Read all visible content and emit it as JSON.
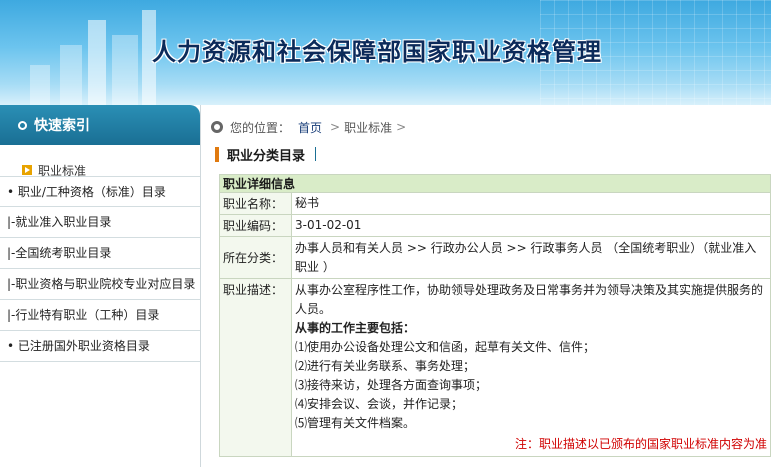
{
  "banner": {
    "title": "人力资源和社会保障部国家职业资格管理"
  },
  "sidebar": {
    "header": "快速索引",
    "sub_item": "职业标准",
    "items": [
      "• 职业/工种资格（标准）目录",
      "|-就业准入职业目录",
      "|-全国统考职业目录",
      "|-职业资格与职业院校专业对应目录",
      "|-行业特有职业（工种）目录",
      "• 已注册国外职业资格目录"
    ]
  },
  "breadcrumb": {
    "prefix": "您的位置：",
    "home": "首页",
    "sep": ">",
    "current": "职业标准",
    "tail_sep": ">"
  },
  "section": {
    "title": "职业分类目录"
  },
  "detail": {
    "header": "职业详细信息",
    "name_label": "职业名称：",
    "name_value": "秘书",
    "code_label": "职业编码：",
    "code_value": "3-01-02-01",
    "category_label": "所在分类：",
    "category_value": "办事人员和有关人员 >> 行政办公人员 >> 行政事务人员 （全国统考职业）（就业准入职业 ）",
    "desc_label": "职业描述：",
    "desc_intro": "从事办公室程序性工作，协助领导处理政务及日常事务并为领导决策及其实施提供服务的人员。",
    "desc_subhead": "从事的工作主要包括：",
    "desc_items": [
      "⑴使用办公设备处理公文和信函，起草有关文件、信件；",
      "⑵进行有关业务联系、事务处理；",
      "⑶接待来访，处理各方面查询事项；",
      "⑷安排会议、会谈，并作记录；",
      "⑸管理有关文件档案。"
    ],
    "note": "注：职业描述以已颁布的国家职业标准内容为准"
  }
}
